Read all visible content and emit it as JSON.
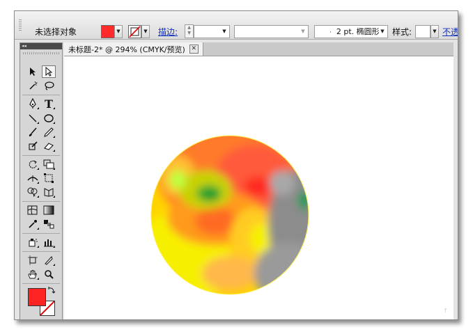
{
  "control_bar": {
    "selection_label": "未选择对象",
    "fill_color": "#ff2a2a",
    "stroke_label": "描边:",
    "stroke_profile": "2 pt. 椭圆形",
    "style_label": "样式:",
    "opacity_link": "不透"
  },
  "tools_panel": {
    "collapse_glyph": "◂◂",
    "fill_color": "#ff2424",
    "stroke_color": "#ffffff"
  },
  "document": {
    "tab_title": "未标题-2* @ 294% (CMYK/预览)",
    "tab_close_glyph": "✕"
  }
}
